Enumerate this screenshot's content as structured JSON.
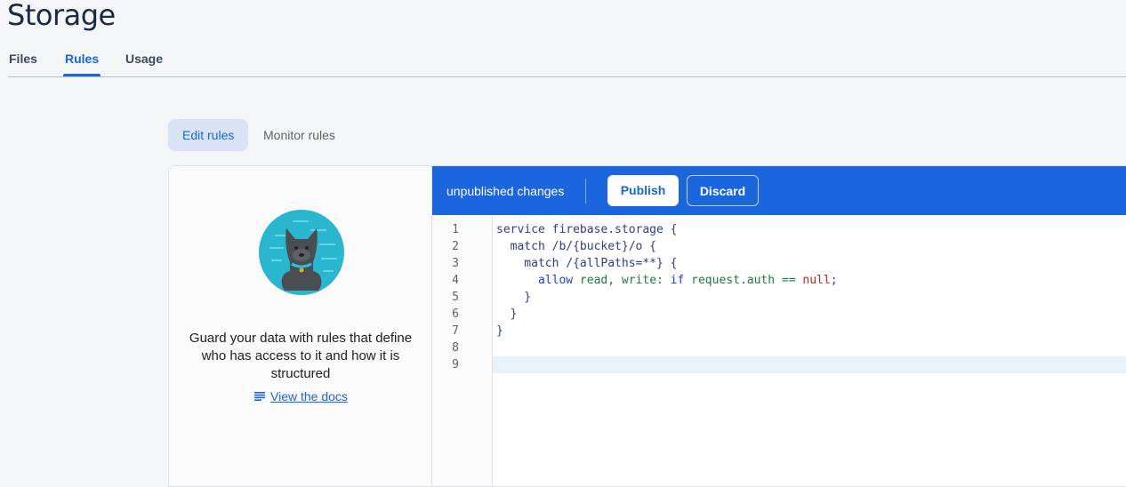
{
  "header": {
    "title": "Storage"
  },
  "tabs": [
    {
      "label": "Files",
      "active": false
    },
    {
      "label": "Rules",
      "active": true
    },
    {
      "label": "Usage",
      "active": false
    }
  ],
  "subtabs": [
    {
      "label": "Edit rules",
      "active": true
    },
    {
      "label": "Monitor rules",
      "active": false
    }
  ],
  "left_panel": {
    "illustration": "guard-dog-icon",
    "description": "Guard your data with rules that define who has access to it and how it is structured",
    "docs_icon": "notes-icon",
    "docs_link": "View the docs"
  },
  "toolbar": {
    "status": "unpublished changes",
    "publish_label": "Publish",
    "discard_label": "Discard",
    "color": "#1b66dc"
  },
  "editor": {
    "line_numbers": [
      "1",
      "2",
      "3",
      "4",
      "5",
      "6",
      "7",
      "8",
      "9"
    ],
    "lines": [
      [
        {
          "t": "service firebase.storage {",
          "c": "kw"
        }
      ],
      [
        {
          "t": "  match /b/{bucket}/o {",
          "c": "kw"
        }
      ],
      [
        {
          "t": "    match /{allPaths=**} {",
          "c": "kw"
        }
      ],
      [
        {
          "t": "      allow ",
          "c": "blu"
        },
        {
          "t": "read, write: ",
          "c": "grn"
        },
        {
          "t": "if ",
          "c": "blu"
        },
        {
          "t": "request.auth == ",
          "c": "grn"
        },
        {
          "t": "null",
          "c": "red"
        },
        {
          "t": ";",
          "c": "kw"
        }
      ],
      [
        {
          "t": "    }",
          "c": "kw"
        }
      ],
      [
        {
          "t": "  }",
          "c": "kw"
        }
      ],
      [
        {
          "t": "}",
          "c": "kw"
        }
      ],
      [
        {
          "t": "",
          "c": "kw"
        }
      ],
      [
        {
          "t": "",
          "c": "kw"
        }
      ]
    ],
    "active_line": 9
  }
}
